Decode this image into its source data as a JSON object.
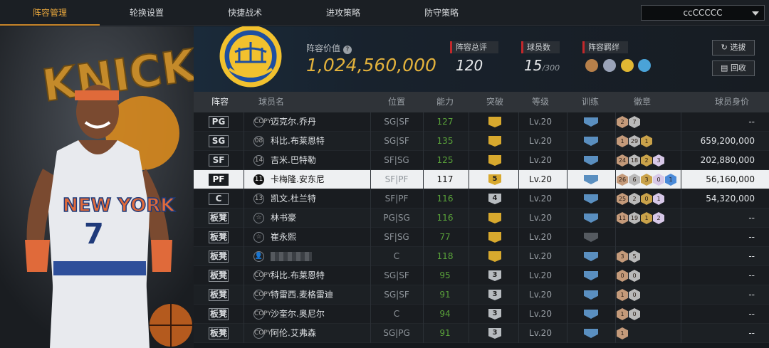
{
  "tabs": [
    "阵容管理",
    "轮换设置",
    "快捷战术",
    "进攻策略",
    "防守策略"
  ],
  "team_select": "ccCCCCC",
  "lineup_value_label": "阵容价值",
  "lineup_value": "1,024,560,000",
  "overall_label": "阵容总评",
  "overall": "120",
  "player_count_label": "球员数",
  "player_count": "15",
  "player_count_max": "/300",
  "bonds_label": "阵容羁绊",
  "btn_pick": "选拔",
  "btn_recall": "回收",
  "headers": [
    "阵容",
    "球员名",
    "位置",
    "能力",
    "突破",
    "等级",
    "训练",
    "徽章",
    "球员身价"
  ],
  "colors": {
    "accent": "#e6a53c",
    "green": "#5aa33a",
    "gold_value": "#e3b23c",
    "red": "#c3282b"
  },
  "rows": [
    {
      "slot": "PG",
      "num": "COPY",
      "name": "迈克尔.乔丹",
      "pos": "SG|SF",
      "ability": "127",
      "breakthrough": "crown",
      "level": "Lv.20",
      "badges": [
        "2",
        "7"
      ],
      "value": "--",
      "green": true
    },
    {
      "slot": "SG",
      "num": "08",
      "name": "科比.布莱恩特",
      "pos": "SG|SF",
      "ability": "135",
      "breakthrough": "crown",
      "level": "Lv.20",
      "badges": [
        "1",
        "29",
        "1"
      ],
      "value": "659,200,000",
      "green": true
    },
    {
      "slot": "SF",
      "num": "14",
      "name": "吉米.巴特勒",
      "pos": "SF|SG",
      "ability": "125",
      "breakthrough": "crown",
      "level": "Lv.20",
      "badges": [
        "24",
        "18",
        "2",
        "3"
      ],
      "value": "202,880,000",
      "green": true
    },
    {
      "slot": "PF",
      "num": "11",
      "name": "卡梅隆.安东尼",
      "pos": "SF|PF",
      "ability": "117",
      "breakthrough": "5",
      "level": "Lv.20",
      "badges": [
        "26",
        "6",
        "3",
        "0",
        "1"
      ],
      "value": "56,160,000",
      "green": false,
      "selected": true
    },
    {
      "slot": "C",
      "num": "13",
      "name": "凯文.杜兰特",
      "pos": "SF|PF",
      "ability": "116",
      "breakthrough": "4",
      "level": "Lv.20",
      "badges": [
        "25",
        "2",
        "0",
        "1"
      ],
      "value": "54,320,000",
      "green": true
    },
    {
      "slot": "板凳",
      "num": "☆",
      "name": "林书豪",
      "pos": "PG|SG",
      "ability": "116",
      "breakthrough": "crown",
      "level": "Lv.20",
      "badges": [
        "11",
        "19",
        "1",
        "2"
      ],
      "value": "--",
      "green": true
    },
    {
      "slot": "板凳",
      "num": "☆",
      "name": "崔永熙",
      "pos": "SF|SG",
      "ability": "77",
      "breakthrough": "crown",
      "level": "Lv.20",
      "badges": [],
      "value": "--",
      "green": true
    },
    {
      "slot": "板凳",
      "num": "👤",
      "name": "",
      "pos": "C",
      "ability": "118",
      "breakthrough": "crown",
      "level": "Lv.20",
      "badges": [
        "3",
        "5"
      ],
      "value": "--",
      "green": true
    },
    {
      "slot": "板凳",
      "num": "COPY",
      "name": "科比.布莱恩特",
      "pos": "SG|SF",
      "ability": "95",
      "breakthrough": "3",
      "level": "Lv.20",
      "badges": [
        "0",
        "0"
      ],
      "value": "--",
      "green": true
    },
    {
      "slot": "板凳",
      "num": "COPY",
      "name": "特雷西.麦格雷迪",
      "pos": "SG|SF",
      "ability": "91",
      "breakthrough": "3",
      "level": "Lv.20",
      "badges": [
        "1",
        "0"
      ],
      "value": "--",
      "green": true
    },
    {
      "slot": "板凳",
      "num": "COPY",
      "name": "沙奎尔.奥尼尔",
      "pos": "C",
      "ability": "94",
      "breakthrough": "3",
      "level": "Lv.20",
      "badges": [
        "1",
        "0"
      ],
      "value": "--",
      "green": true
    },
    {
      "slot": "板凳",
      "num": "COPY",
      "name": "阿伦.艾弗森",
      "pos": "SG|PG",
      "ability": "91",
      "breakthrough": "3",
      "level": "Lv.20",
      "badges": [
        "1"
      ],
      "value": "--",
      "green": true
    }
  ]
}
